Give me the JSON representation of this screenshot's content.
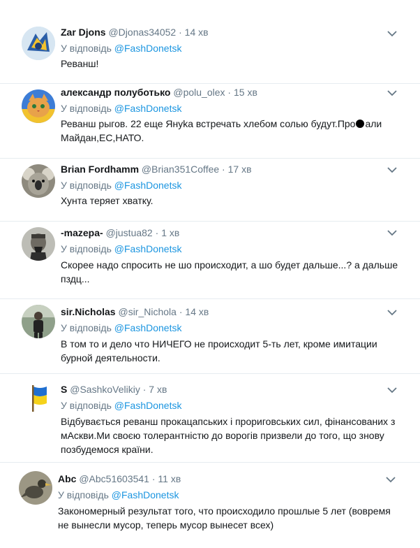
{
  "reply_prefix": "У відповідь",
  "tweets": [
    {
      "name": "Zar Djons",
      "handle": "@Djonas34052",
      "time": "14 хв",
      "reply_to": "@FashDonetsk",
      "text": "Реванш!",
      "avatar_icon": "blue-yellow-figure-avatar"
    },
    {
      "name": "александр полуботько",
      "handle": "@polu_olex",
      "time": "15 хв",
      "reply_to": "@FashDonetsk",
      "text_before": "Реванш рыгов. 22 еще Януka встречать хлебом солью будут.Про",
      "text_after": "али Майдан,ЕС,НАТО.",
      "avatar_icon": "cat-avatar"
    },
    {
      "name": "Brian Fordhamm",
      "handle": "@Brian351Coffee",
      "time": "17 хв",
      "reply_to": "@FashDonetsk",
      "text": "Хунта теряет хватку.",
      "avatar_icon": "koala-avatar"
    },
    {
      "name": "-mazepa-",
      "handle": "@justua82",
      "time": "1 хв",
      "reply_to": "@FashDonetsk",
      "text": "Скорее надо спросить не шо происходит, а шо будет дальше...? а дальше пздц...",
      "avatar_icon": "portrait-avatar"
    },
    {
      "name": "sir.Nicholas",
      "handle": "@sir_Nichola",
      "time": "14 хв",
      "reply_to": "@FashDonetsk",
      "text": "В том то и дело что НИЧЕГО не происходит 5-ть лет, кроме имитации бурной деятельности.",
      "avatar_icon": "person-avatar"
    },
    {
      "name": "S",
      "handle": "@SashkoVelikiy",
      "time": "7 хв",
      "reply_to": "@FashDonetsk",
      "text": "Відбувається реванш прокацапських і проригов­ських сил, фінансованих з мАскви.Ми своєю толерантністю до ворогів призвели до того, що знову позбудемося країни.",
      "avatar_icon": "ukraine-flag-avatar"
    },
    {
      "name": "Abc",
      "handle": "@Abc51603541",
      "time": "11 хв",
      "reply_to": "@FashDonetsk",
      "text": "Закономерный результат того, что происходило прошлые 5 лет (вовремя не вынесли мусор, теперь мусор вынесет всех)",
      "avatar_icon": "bird-avatar"
    }
  ]
}
